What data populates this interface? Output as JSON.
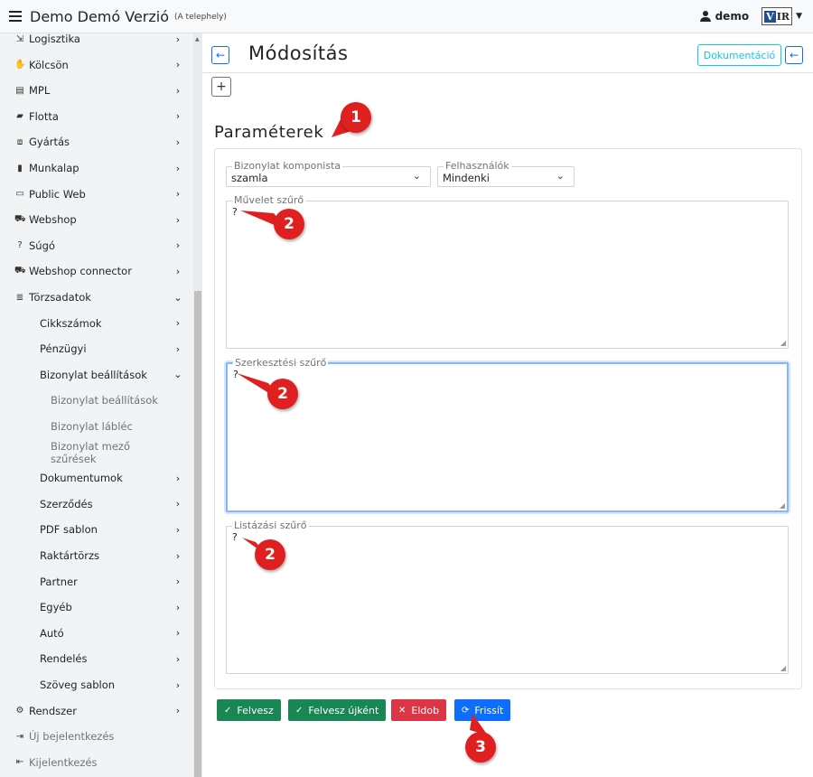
{
  "header": {
    "app_title": "Demo Demó Verzió",
    "app_subtitle": "(A telephely)",
    "user": "demo",
    "logo_text": "VIR"
  },
  "sidebar": {
    "items": [
      {
        "label": "Logisztika",
        "icon": "truck-icon",
        "glyph": "⇲",
        "chevron": "›",
        "level": 1
      },
      {
        "label": "Kölcsön",
        "icon": "hand-icon",
        "glyph": "✋",
        "chevron": "›",
        "level": 1
      },
      {
        "label": "MPL",
        "icon": "shipping-icon",
        "glyph": "▤",
        "chevron": "›",
        "level": 1
      },
      {
        "label": "Flotta",
        "icon": "car-icon",
        "glyph": "▰",
        "chevron": "›",
        "level": 1
      },
      {
        "label": "Gyártás",
        "icon": "cubes-icon",
        "glyph": "⧈",
        "chevron": "›",
        "level": 1
      },
      {
        "label": "Munkalap",
        "icon": "file-icon",
        "glyph": "▮",
        "chevron": "›",
        "level": 1
      },
      {
        "label": "Public Web",
        "icon": "display-icon",
        "glyph": "▭",
        "chevron": "›",
        "level": 1
      },
      {
        "label": "Webshop",
        "icon": "cart-icon",
        "glyph": "⛟",
        "chevron": "›",
        "level": 1
      },
      {
        "label": "Súgó",
        "icon": "help-icon",
        "glyph": "?",
        "chevron": "›",
        "level": 1
      },
      {
        "label": "Webshop connector",
        "icon": "cart-icon",
        "glyph": "⛟",
        "chevron": "›",
        "level": 1
      },
      {
        "label": "Törzsadatok",
        "icon": "database-icon",
        "glyph": "≣",
        "chevron": "⌄",
        "level": 1
      },
      {
        "label": "Cikkszámok",
        "chevron": "›",
        "level": 2
      },
      {
        "label": "Pénzügyi",
        "chevron": "›",
        "level": 2
      },
      {
        "label": "Bizonylat beállítások",
        "chevron": "⌄",
        "level": 2
      },
      {
        "label": "Bizonylat beállítások",
        "chevron": "",
        "level": 3
      },
      {
        "label": "Bizonylat lábléc",
        "chevron": "",
        "level": 3
      },
      {
        "label": "Bizonylat mező szűrések",
        "chevron": "",
        "level": 3
      },
      {
        "label": "Dokumentumok",
        "chevron": "›",
        "level": 2
      },
      {
        "label": "Szerződés",
        "chevron": "›",
        "level": 2
      },
      {
        "label": "PDF sablon",
        "chevron": "›",
        "level": 2
      },
      {
        "label": "Raktártörzs",
        "chevron": "›",
        "level": 2
      },
      {
        "label": "Partner",
        "chevron": "›",
        "level": 2
      },
      {
        "label": "Egyéb",
        "chevron": "›",
        "level": 2
      },
      {
        "label": "Autó",
        "chevron": "›",
        "level": 2
      },
      {
        "label": "Rendelés",
        "chevron": "›",
        "level": 2
      },
      {
        "label": "Szöveg sablon",
        "chevron": "›",
        "level": 2
      },
      {
        "label": "Rendszer",
        "icon": "cogs-icon",
        "glyph": "⚙",
        "chevron": "›",
        "level": 1
      },
      {
        "label": "Új bejelentkezés",
        "icon": "login-icon",
        "glyph": "⇥",
        "chevron": "",
        "level": 1,
        "muted": true
      },
      {
        "label": "Kijelentkezés",
        "icon": "logout-icon",
        "glyph": "⇤",
        "chevron": "",
        "level": 1,
        "muted": true
      }
    ]
  },
  "page": {
    "title": "Módosítás",
    "doc_button": "Dokumentáció",
    "section_title": "Paraméterek"
  },
  "form": {
    "bizonylat_komponista": {
      "label": "Bizonylat komponista",
      "value": "szamla"
    },
    "felhasznalok": {
      "label": "Felhasználók",
      "value": "Mindenki"
    },
    "muvelet_szuro": {
      "label": "Művelet szűrő",
      "value": "?"
    },
    "szerkesztesi_szuro": {
      "label": "Szerkesztési szűrő",
      "value": "?"
    },
    "listazasi_szuro": {
      "label": "Listázási szűrő",
      "value": "?"
    }
  },
  "actions": {
    "felvesz": "Felvesz",
    "felvesz_ujkent": "Felvesz újként",
    "eldob": "Eldob",
    "frissit": "Frissít"
  },
  "callouts": [
    "1",
    "2",
    "2",
    "2",
    "3"
  ],
  "colors": {
    "primary": "#0d6efd",
    "success": "#198754",
    "danger": "#dc3545",
    "info": "#0dcaf0",
    "callout": "#e02020"
  }
}
